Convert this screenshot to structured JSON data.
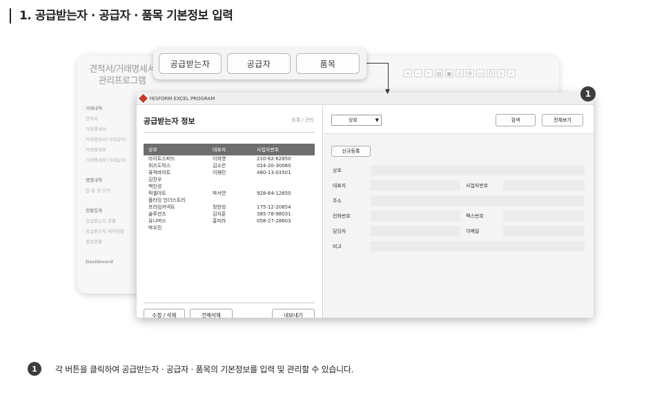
{
  "heading": "1. 공급받는자 · 공급자 · 품목 기본정보 입력",
  "background_window": {
    "app_title_line1": "견적서/거래명세서",
    "app_title_line2": "관리프로그램",
    "menu": [
      "거래내역",
      "견적서",
      "거래명세서",
      "거래명세서(거래일자)",
      "거래명세표",
      "거래명세표(거래일자)",
      "명명내역",
      "입·출 및 성적",
      "현황집계",
      "공급받는자 현황",
      "공급받는자 세부현황",
      "품목현황",
      "Dashboard"
    ]
  },
  "tabs": [
    "공급받는자",
    "공급자",
    "품목"
  ],
  "window": {
    "title": "YESFORM EXCEL PROGRAM",
    "left_panel": {
      "title": "공급받는자 정보",
      "breadcrumb": "등록 / 관리",
      "columns": [
        "상호",
        "대표자",
        "사업자번호"
      ],
      "rows": [
        [
          "라이트스피드",
          "이희영",
          "210-62-62850"
        ],
        [
          "위즈도믹스",
          "김소은",
          "024-20-30060"
        ],
        [
          "퓨쳐바이트",
          "이재민",
          "480-13-03501"
        ],
        [
          "김진우",
          "",
          ""
        ],
        [
          "백인성",
          "",
          ""
        ],
        [
          "픽셀아트",
          "박서연",
          "928-64-12650"
        ],
        [
          "플라잉 인더스트리",
          "",
          ""
        ],
        [
          "프라임커넥트",
          "정한성",
          "175-12-20854"
        ],
        [
          "솔루션즈",
          "김지훈",
          "385-78-98031"
        ],
        [
          "유니버스",
          "홍미라",
          "058-27-28603"
        ],
        [
          "박우진",
          "",
          ""
        ]
      ],
      "edit_delete_button": "수정 / 삭제",
      "delete_all_button": "전체삭제",
      "export_button": "내보내기"
    },
    "right_panel": {
      "search_select_value": "상호",
      "search_button": "검색",
      "view_all_button": "전체보기",
      "new_button": "신규등록",
      "labels": {
        "name": "상호",
        "ceo": "대표자",
        "biz_no": "사업자번호",
        "address": "주소",
        "phone": "전화번호",
        "fax": "팩스번호",
        "manager": "담당자",
        "email": "이메일",
        "memo": "비고"
      }
    }
  },
  "badge_number": "1",
  "footnote": "각 버튼을 클릭하여 공급받는자 · 공급자 · 품목의 기본정보를 입력 및 관리할 수 있습니다."
}
